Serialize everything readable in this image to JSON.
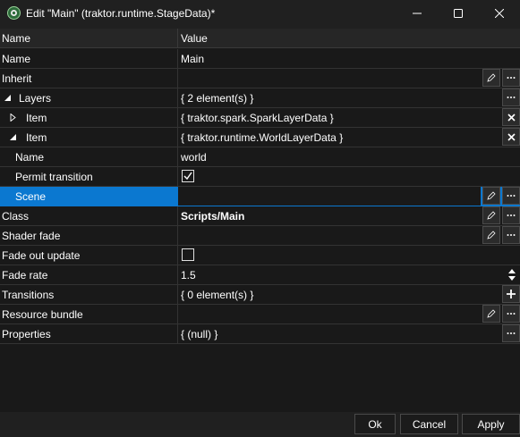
{
  "window": {
    "title": "Edit \"Main\" (traktor.runtime.StageData)*"
  },
  "grid": {
    "headers": {
      "name": "Name",
      "value": "Value"
    },
    "rows": [
      {
        "name": "Name",
        "value": "Main"
      },
      {
        "name": "Inherit",
        "value": ""
      },
      {
        "name": "Layers",
        "value": "{ 2 element(s) }"
      },
      {
        "name": "Item",
        "value": "{ traktor.spark.SparkLayerData }"
      },
      {
        "name": "Item",
        "value": "{ traktor.runtime.WorldLayerData }"
      },
      {
        "name": "Name",
        "value": "world"
      },
      {
        "name": "Permit transition",
        "value": "",
        "checked": true
      },
      {
        "name": "Scene",
        "value": "",
        "selected": true
      },
      {
        "name": "Class",
        "value": "Scripts/Main"
      },
      {
        "name": "Shader fade",
        "value": ""
      },
      {
        "name": "Fade out update",
        "value": "",
        "checked": false
      },
      {
        "name": "Fade rate",
        "value": "1.5"
      },
      {
        "name": "Transitions",
        "value": "{ 0 element(s) }"
      },
      {
        "name": "Resource bundle",
        "value": ""
      },
      {
        "name": "Properties",
        "value": "{ (null) }"
      }
    ]
  },
  "buttons": {
    "ok": "Ok",
    "cancel": "Cancel",
    "apply": "Apply"
  },
  "colors": {
    "selection": "#0b78d0",
    "background": "#191919",
    "titlebar": "#202020"
  }
}
